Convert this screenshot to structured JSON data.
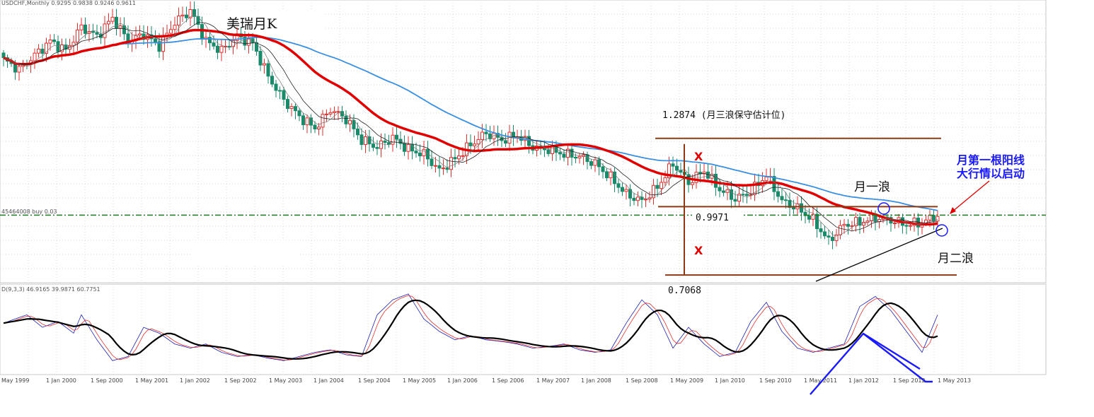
{
  "chart_data": {
    "type": "candlestick",
    "title": "美瑞月K",
    "instrument_header": "USDCHF,Monthly  0.9295 0.9838 0.9246 0.9611",
    "price_line_label": "45464008 buy 0.03",
    "stoch_header": "D(9,3,3) 46.9165 39.9871 60.7751",
    "x_ticks": [
      "May 1999",
      "1 Jan 2000",
      "1 Sep 2000",
      "1 May 2001",
      "1 Jan 2002",
      "1 Sep 2002",
      "1 May 2003",
      "1 Jan 2004",
      "1 Sep 2004",
      "1 May 2005",
      "1 Jan 2006",
      "1 Sep 2006",
      "1 May 2007",
      "1 Jan 2008",
      "1 Sep 2008",
      "1 May 2009",
      "1 Jan 2010",
      "1 Sep 2010",
      "1 May 2011",
      "1 Jan 2012",
      "1 Sep 2012",
      "1 May 2013"
    ],
    "ylim": [
      0.68,
      1.86
    ],
    "close_anchors": [
      [
        0,
        1.62
      ],
      [
        4,
        1.58
      ],
      [
        8,
        1.64
      ],
      [
        12,
        1.7
      ],
      [
        16,
        1.66
      ],
      [
        20,
        1.76
      ],
      [
        24,
        1.72
      ],
      [
        28,
        1.8
      ],
      [
        32,
        1.7
      ],
      [
        36,
        1.73
      ],
      [
        40,
        1.68
      ],
      [
        44,
        1.78
      ],
      [
        48,
        1.83
      ],
      [
        52,
        1.7
      ],
      [
        56,
        1.66
      ],
      [
        60,
        1.72
      ],
      [
        64,
        1.69
      ],
      [
        68,
        1.55
      ],
      [
        72,
        1.45
      ],
      [
        76,
        1.38
      ],
      [
        80,
        1.33
      ],
      [
        84,
        1.41
      ],
      [
        88,
        1.37
      ],
      [
        92,
        1.28
      ],
      [
        96,
        1.25
      ],
      [
        100,
        1.29
      ],
      [
        104,
        1.24
      ],
      [
        108,
        1.22
      ],
      [
        112,
        1.15
      ],
      [
        116,
        1.2
      ],
      [
        120,
        1.26
      ],
      [
        124,
        1.31
      ],
      [
        128,
        1.28
      ],
      [
        132,
        1.3
      ],
      [
        136,
        1.25
      ],
      [
        140,
        1.24
      ],
      [
        144,
        1.22
      ],
      [
        148,
        1.21
      ],
      [
        152,
        1.18
      ],
      [
        156,
        1.12
      ],
      [
        160,
        1.05
      ],
      [
        164,
        1.02
      ],
      [
        168,
        1.08
      ],
      [
        172,
        1.18
      ],
      [
        176,
        1.1
      ],
      [
        180,
        1.15
      ],
      [
        184,
        1.07
      ],
      [
        188,
        1.03
      ],
      [
        192,
        1.06
      ],
      [
        196,
        1.13
      ],
      [
        200,
        1.02
      ],
      [
        204,
        0.99
      ],
      [
        208,
        0.94
      ],
      [
        212,
        0.85
      ],
      [
        216,
        0.92
      ],
      [
        220,
        0.93
      ],
      [
        224,
        0.95
      ],
      [
        228,
        0.94
      ],
      [
        232,
        0.92
      ],
      [
        236,
        0.93
      ],
      [
        240,
        0.96
      ]
    ],
    "indicators": [
      "MA 5",
      "MA 10",
      "MA 30 (red)",
      "MA 60 (blue)"
    ],
    "horizontal_price_line": 0.9611,
    "levels": [
      {
        "value": 1.2874,
        "label": "1.2874 (月三浪保守估计位)"
      },
      {
        "value": 0.9971,
        "label": "0.9971"
      },
      {
        "value": 0.7068,
        "label": "0.7068"
      }
    ],
    "x_marks": [
      "X",
      "X"
    ],
    "annotations": {
      "wave1": "月一浪",
      "wave2": "月二浪",
      "note_line1": "月第一根阳线",
      "note_line2": "大行情以启动"
    },
    "stochastic": {
      "k_anchors": [
        [
          0,
          60
        ],
        [
          6,
          70
        ],
        [
          10,
          55
        ],
        [
          14,
          62
        ],
        [
          18,
          48
        ],
        [
          20,
          70
        ],
        [
          24,
          40
        ],
        [
          28,
          15
        ],
        [
          32,
          20
        ],
        [
          36,
          55
        ],
        [
          40,
          48
        ],
        [
          44,
          35
        ],
        [
          48,
          30
        ],
        [
          52,
          35
        ],
        [
          56,
          25
        ],
        [
          60,
          20
        ],
        [
          64,
          22
        ],
        [
          68,
          18
        ],
        [
          72,
          15
        ],
        [
          76,
          20
        ],
        [
          80,
          25
        ],
        [
          84,
          28
        ],
        [
          88,
          22
        ],
        [
          92,
          20
        ],
        [
          96,
          70
        ],
        [
          100,
          88
        ],
        [
          104,
          95
        ],
        [
          108,
          65
        ],
        [
          112,
          50
        ],
        [
          116,
          40
        ],
        [
          120,
          45
        ],
        [
          124,
          40
        ],
        [
          128,
          38
        ],
        [
          132,
          35
        ],
        [
          136,
          30
        ],
        [
          140,
          32
        ],
        [
          144,
          35
        ],
        [
          148,
          28
        ],
        [
          152,
          25
        ],
        [
          156,
          28
        ],
        [
          160,
          60
        ],
        [
          164,
          88
        ],
        [
          168,
          70
        ],
        [
          172,
          30
        ],
        [
          176,
          55
        ],
        [
          180,
          35
        ],
        [
          184,
          20
        ],
        [
          188,
          25
        ],
        [
          192,
          62
        ],
        [
          196,
          85
        ],
        [
          200,
          50
        ],
        [
          204,
          30
        ],
        [
          208,
          25
        ],
        [
          212,
          30
        ],
        [
          216,
          35
        ],
        [
          220,
          80
        ],
        [
          224,
          92
        ],
        [
          228,
          75
        ],
        [
          232,
          50
        ],
        [
          236,
          25
        ],
        [
          240,
          70
        ]
      ]
    }
  }
}
